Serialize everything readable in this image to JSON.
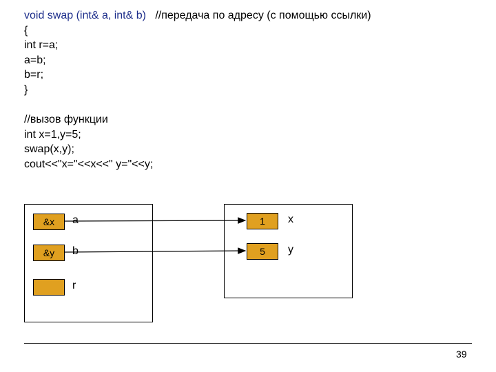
{
  "code": {
    "l1a": "void swap (int& a, int& b)   ",
    "l1b": "//передача по адресу (с помощью ссылки)",
    "l2": "{",
    "l3": "int r=a;",
    "l4": "a=b;",
    "l5": "b=r;",
    "l6": "}",
    "l7": " ",
    "l8": "//вызов функции",
    "l9": "int x=1,y=5;",
    "l10": "swap(x,y);",
    "l11": "cout<<\"x=\"<<x<<\" y=\"<<y;"
  },
  "left": {
    "cell_a": "&x",
    "cell_b": "&y",
    "cell_r": "",
    "label_a": "a",
    "label_b": "b",
    "label_r": "r"
  },
  "right": {
    "cell_x": "1",
    "cell_y": "5",
    "label_x": "x",
    "label_y": "y"
  },
  "page_number": "39"
}
